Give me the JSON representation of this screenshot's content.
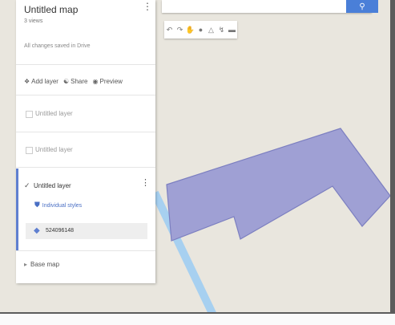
{
  "map_title": "Untitled map",
  "views": "3 views",
  "saved_status": "All changes saved in Drive",
  "actions": {
    "add_layer": "Add layer",
    "share": "Share",
    "preview": "Preview"
  },
  "layers": [
    {
      "label": "Untitled layer",
      "checked": false
    },
    {
      "label": "Untitled layer",
      "checked": false
    },
    {
      "label": "Untitled layer",
      "checked": true
    }
  ],
  "layer_style": "Individual styles",
  "feature_label": "524096148",
  "base_map": "Base map",
  "icons": {
    "search": "search-icon",
    "undo": "undo-icon",
    "redo": "redo-icon",
    "hand": "hand-icon",
    "marker": "marker-icon",
    "polygon": "polygon-icon",
    "route": "route-icon",
    "ruler": "ruler-icon",
    "menu": "more-vert-icon",
    "add_layer": "add-layer-icon",
    "share": "share-icon",
    "preview": "preview-icon",
    "paint": "paint-icon",
    "shape": "shape-icon",
    "expand": "expand-icon"
  },
  "colors": {
    "polygon_fill": "#9fa0d4",
    "polygon_stroke": "#7c7fc0",
    "river": "#a7d0f0",
    "map_bg": "#e9e6de",
    "accent": "#4a7fd8"
  }
}
